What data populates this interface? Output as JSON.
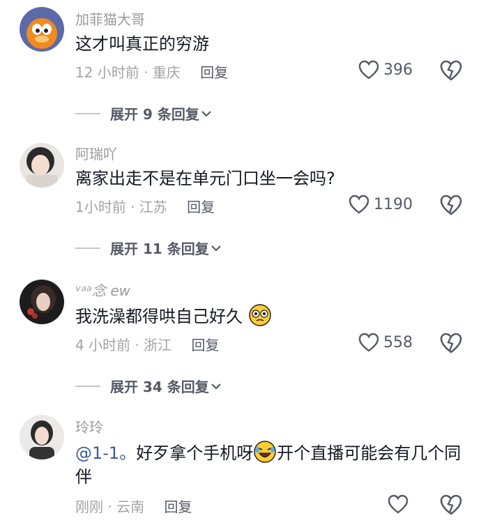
{
  "comments": [
    {
      "username": "加菲猫大哥",
      "text": "这才叫真正的穷游",
      "time": "12 小时前 · 重庆",
      "reply": "回复",
      "likes": "396",
      "expand": "展开 9 条回复"
    },
    {
      "username": "阿瑞吖",
      "text": "离家出走不是在单元门口坐一会吗?",
      "time": "1小时前 · 江苏",
      "reply": "回复",
      "likes": "1190",
      "expand": "展开 11 条回复"
    },
    {
      "username": "ᵛᵃᵃ念 ew",
      "text": "我洗澡都得哄自己好久",
      "time": "4 小时前 · 浙江",
      "reply": "回复",
      "likes": "558",
      "expand": "展开 34 条回复"
    },
    {
      "username": "玲玲",
      "mention": "@1-1。",
      "text_part1": "好歹拿个手机呀",
      "text_part2": "开个直播可能会有几个同伴",
      "time": "刚刚 · 云南",
      "reply": "回复",
      "likes": ""
    }
  ],
  "icons": {
    "like": "heart-outline-icon",
    "dislike": "broken-heart-icon",
    "expand": "chevron-down-icon"
  },
  "colors": {
    "text": "#161823",
    "muted": "#a3a3a3",
    "mention": "#3a5a9a"
  }
}
